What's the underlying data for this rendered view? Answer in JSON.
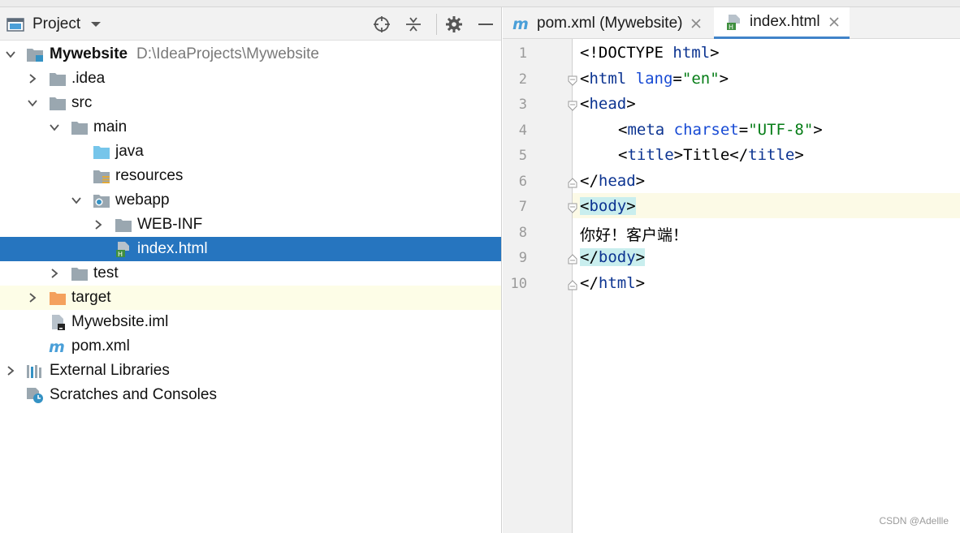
{
  "panel": {
    "title": "Project"
  },
  "tree": [
    {
      "label": "Mywebsite",
      "path": "D:\\IdeaProjects\\Mywebsite"
    },
    {
      "label": ".idea"
    },
    {
      "label": "src"
    },
    {
      "label": "main"
    },
    {
      "label": "java"
    },
    {
      "label": "resources"
    },
    {
      "label": "webapp"
    },
    {
      "label": "WEB-INF"
    },
    {
      "label": "index.html"
    },
    {
      "label": "test"
    },
    {
      "label": "target"
    },
    {
      "label": "Mywebsite.iml"
    },
    {
      "label": "pom.xml"
    },
    {
      "label": "External Libraries"
    },
    {
      "label": "Scratches and Consoles"
    }
  ],
  "tabs": [
    {
      "label": "pom.xml (Mywebsite)"
    },
    {
      "label": "index.html"
    }
  ],
  "line_numbers": [
    "1",
    "2",
    "3",
    "4",
    "5",
    "6",
    "7",
    "8",
    "9",
    "10"
  ],
  "code": {
    "l1a": "<!DOCTYPE ",
    "l1b": "html",
    "l1c": ">",
    "l2a": "<",
    "l2b": "html",
    "l2c": " lang",
    "l2d": "=",
    "l2e": "\"en\"",
    "l2f": ">",
    "l3a": "<",
    "l3b": "head",
    "l3c": ">",
    "l4a": "<",
    "l4b": "meta",
    "l4c": " charset",
    "l4d": "=",
    "l4e": "\"UTF-8\"",
    "l4f": ">",
    "l5a": "<",
    "l5b": "title",
    "l5c": ">Title</",
    "l5d": "title",
    "l5e": ">",
    "l6a": "</",
    "l6b": "head",
    "l6c": ">",
    "l7a": "<",
    "l7b": "body",
    "l7c": ">",
    "l8": "你好！客户端！",
    "l9a": "</",
    "l9b": "body",
    "l9c": ">",
    "l10a": "</",
    "l10b": "html",
    "l10c": ">"
  },
  "watermark": "CSDN @Adellle",
  "colors": {
    "selection": "#2675bf",
    "accent_tab_underline": "#4083c9",
    "tag": "#0c3491",
    "attribute": "#174ad4",
    "string": "#067d17",
    "highlight_line": "#fcfae6"
  },
  "icons": {
    "header": [
      "project-icon",
      "dropdown-icon",
      "locate-icon",
      "collapse-icon",
      "gear-icon",
      "minimize-icon"
    ],
    "tree": [
      "module-icon",
      "folder-icon",
      "source-folder-icon",
      "resources-folder-icon",
      "web-folder-icon",
      "html-file-icon",
      "excluded-folder-icon",
      "iml-file-icon",
      "maven-icon",
      "libraries-icon",
      "scratches-icon"
    ]
  }
}
